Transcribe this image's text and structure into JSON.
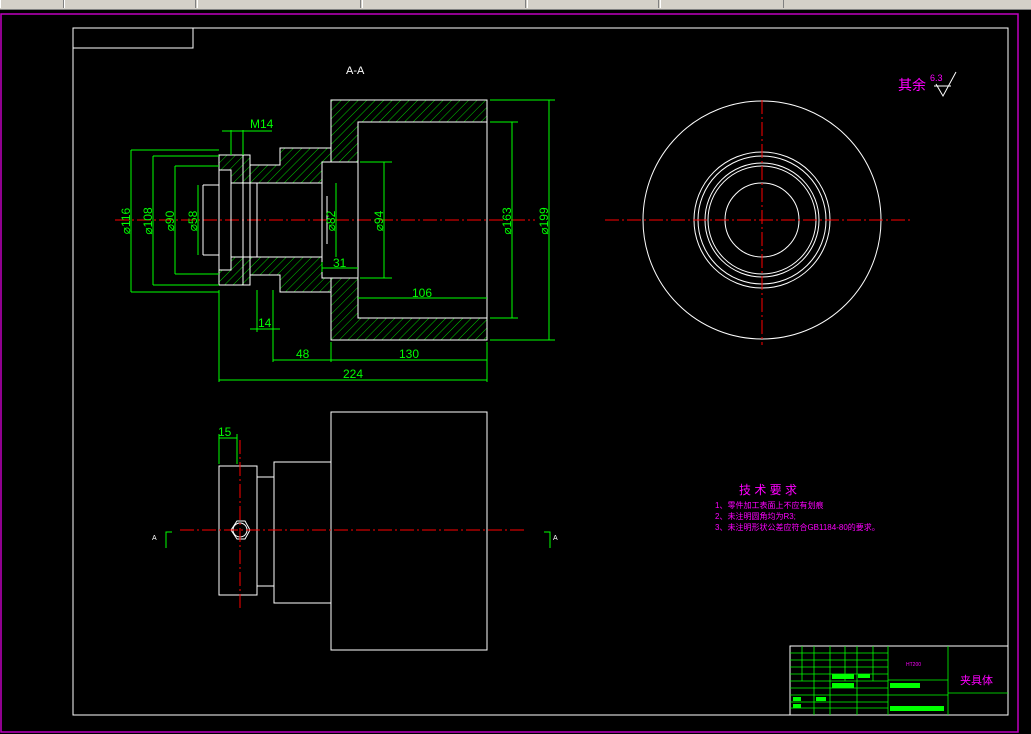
{
  "drawing": {
    "section_mark": "A-A",
    "surface_finish_label": "其余",
    "surface_finish_value": "6.3",
    "view_label_left": "A",
    "view_label_right": "A",
    "dimensions": {
      "d116": "⌀116",
      "d108": "⌀108",
      "d90": "⌀90",
      "d58": "⌀58",
      "d82": "⌀82",
      "d94": "⌀94",
      "d163": "⌀163",
      "d199": "⌀199",
      "m14": "M14",
      "l31": "31",
      "l106": "106",
      "l14": "14",
      "l48": "48",
      "l130": "130",
      "l224": "224",
      "l15": "15"
    }
  },
  "tech_requirements": {
    "title": "技 术 要 求",
    "items": [
      "1、零件加工表面上不应有划痕",
      "2、未注明圆角均为R3;",
      "3、未注明形状公差应符合GB1184-80的要求。"
    ]
  },
  "title_block": {
    "material": "HT200",
    "part_name": "夹具体"
  },
  "colors": {
    "outline": "#ffffff",
    "dimension": "#00ff00",
    "centerline": "#ff0000",
    "annotation": "#ff00ff",
    "hatch": "#00ff00",
    "sheet_border": "#c000c0"
  }
}
